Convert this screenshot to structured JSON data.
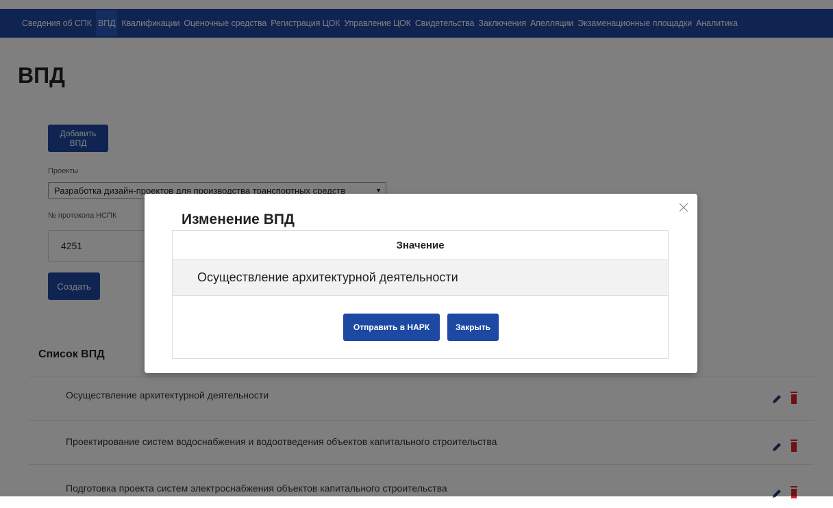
{
  "nav": {
    "items": [
      "Сведения об СПК",
      "ВПД",
      "Квалификации",
      "Оценочные средства",
      "Регистрация ЦОК",
      "Управление ЦОК",
      "Свидетельства",
      "Заключения",
      "Апелляции",
      "Экзаменационные площадки",
      "Аналитика"
    ],
    "active": "ВПД",
    "color": "#1e49a3"
  },
  "page": {
    "title": "ВПД"
  },
  "form": {
    "add_button": "Добавить ВПД",
    "projects_label": "Проекты",
    "projects_value": "Разработка дизайн-проектов для производства транспортных средств",
    "protocol_label": "№ протокола НСПК",
    "protocol_value": "4251",
    "create_button": "Создать"
  },
  "list": {
    "title": "Список ВПД",
    "items": [
      "Осуществление архитектурной деятельности",
      "Проектирование систем водоснабжения и водоотведения объектов капитального строительства",
      "Подготовка проекта систем электроснабжения объектов капитального строительства"
    ]
  },
  "modal": {
    "title": "Изменение ВПД",
    "column_header": "Значение",
    "value": "Осуществление архитектурной деятельности",
    "send_button": "Отправить в НАРК",
    "close_button": "Закрыть"
  },
  "colors": {
    "accent": "#1e49a3",
    "danger": "#d9232d"
  },
  "icons": {
    "edit": "pencil-icon",
    "delete": "trash-icon",
    "close": "close-icon",
    "caret": "caret-down-icon"
  }
}
